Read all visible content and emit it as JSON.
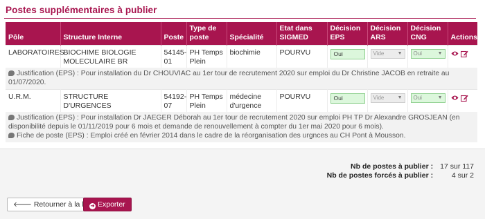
{
  "section": {
    "title": "Postes supplémentaires à publier"
  },
  "columns": [
    "Pôle",
    "Structure Interne",
    "Poste",
    "Type de poste",
    "Spécialité",
    "Etat dans SIGMED",
    "Décision EPS",
    "Décision ARS",
    "Décision CNG",
    "Actions"
  ],
  "rows": [
    {
      "pole": "LABORATOIRES",
      "structure": "BIOCHIME BIOLOGIE MOLECULAIRE BR",
      "poste": "54145-01",
      "type": "PH Temps Plein",
      "specialite": "biochimie",
      "etat": "POURVU",
      "decision_eps": "Oui",
      "decision_ars": "Vide",
      "decision_cng": "Oui",
      "justifications": [
        "Justification (EPS) : Pour installation du Dr CHOUVIAC au 1er tour de recrutement 2020 sur emploi du Dr Christine JACOB en retraite au 01/07/2020."
      ]
    },
    {
      "pole": "U.R.M.",
      "structure": "STRUCTURE D'URGENCES",
      "poste": "54192-07",
      "type": "PH Temps Plein",
      "specialite": "médecine d'urgence",
      "etat": "POURVU",
      "decision_eps": "Oui",
      "decision_ars": "Vide",
      "decision_cng": "Oui",
      "justifications": [
        "Justification (EPS) : Pour installation Dr JAEGER Déborah au 1er tour de recrutement 2020 sur emploi PH TP Dr Alexandre GROSJEAN (en disponibilité depuis le 01/11/2019 pour 6 mois et demande de renouvellement à compter du 1er mai 2020 pour 6 mois).",
        "Fiche de poste (EPS) : Emploi créé en février 2014 dans le cadre de la réorganisation des urgnces au CH Pont à Mousson."
      ]
    }
  ],
  "totals": {
    "publier_label": "Nb de postes à publier :",
    "publier_value": "17 sur 117",
    "forces_label": "Nb de postes forcés à publier :",
    "forces_value": "4 sur 2"
  },
  "buttons": {
    "back": "Retourner à la liste",
    "export": "Exporter"
  },
  "colors": {
    "accent": "#a8154f",
    "eps_bg": "#dcf7dc"
  },
  "icons": {
    "comment": "comment-icon",
    "view": "eye-icon",
    "edit": "edit-icon",
    "back": "arrow-left-icon",
    "export": "circle-arrow-icon"
  }
}
